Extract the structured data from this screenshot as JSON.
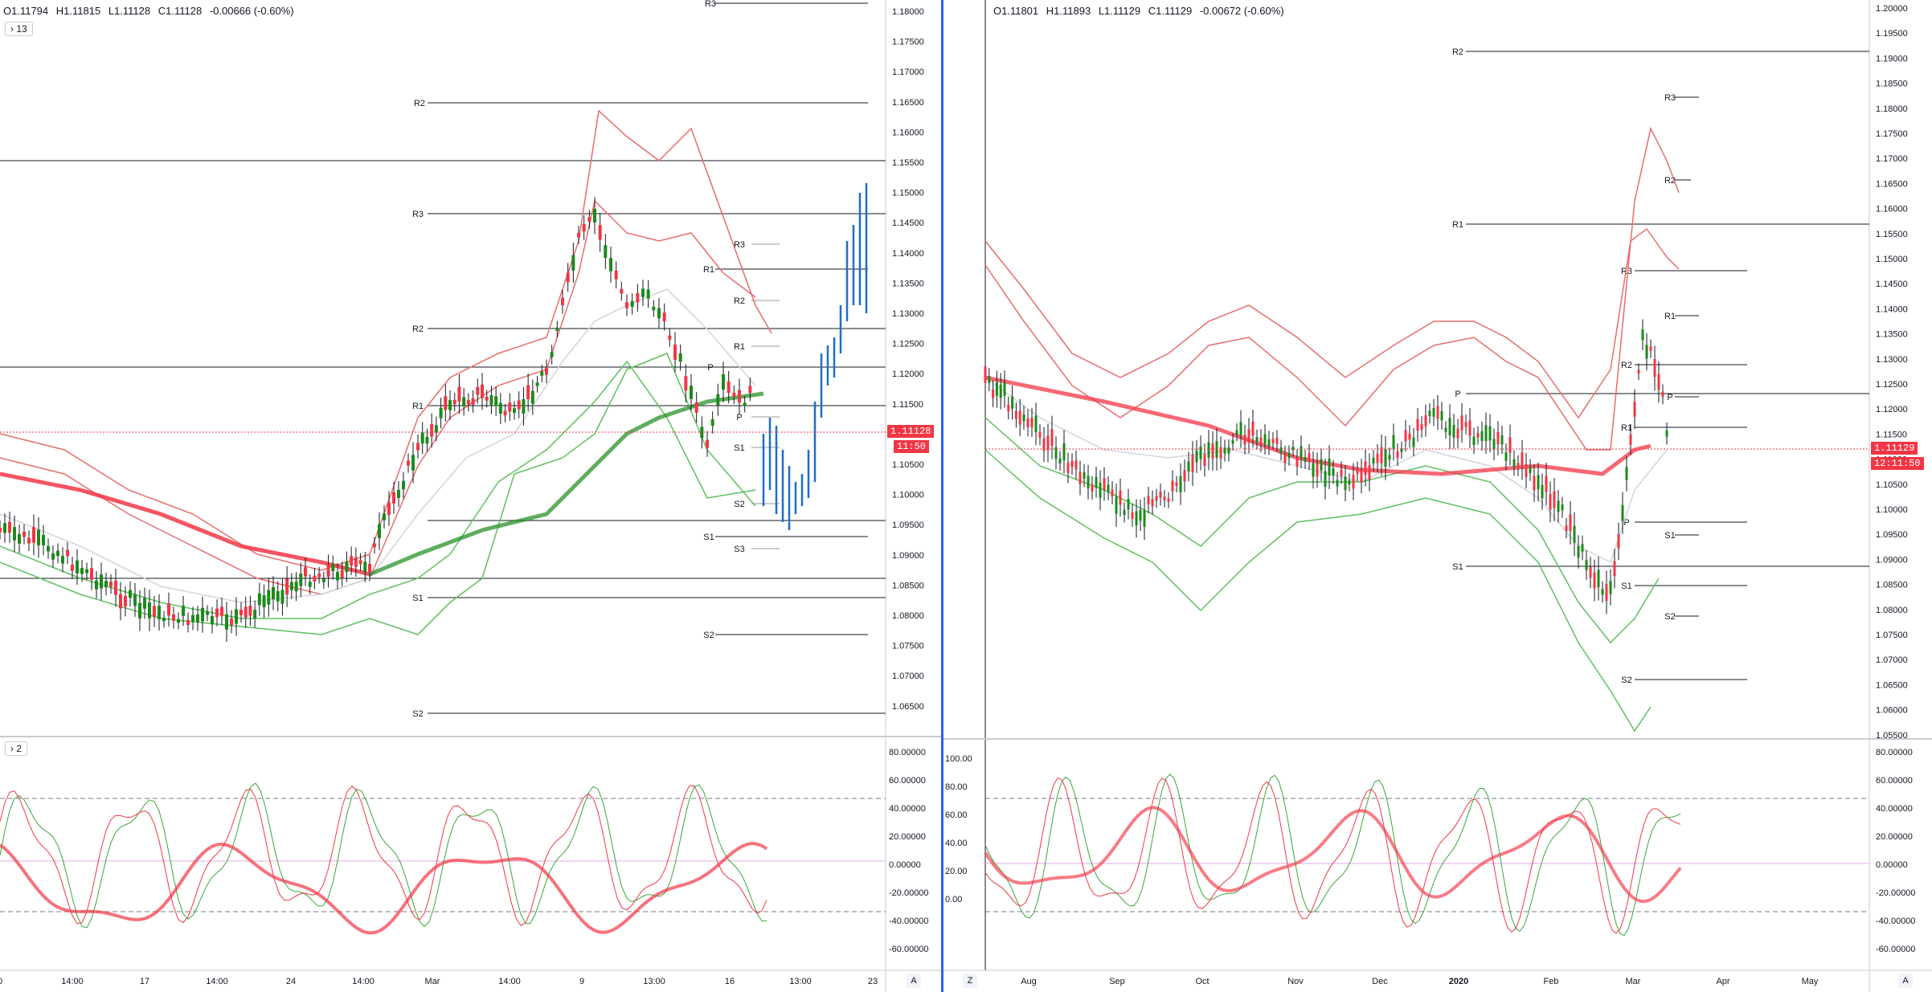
{
  "left": {
    "ohlc": {
      "open": "O1.11794",
      "high": "H1.11815",
      "low": "L1.11128",
      "close": "C1.11128",
      "change": "-0.00666 (-0.60%)"
    },
    "price_chip": "13",
    "osc_chip": "2",
    "last_price": "1.11128",
    "countdown": "11:50",
    "price_axis": [
      "1.18000",
      "1.17500",
      "1.17000",
      "1.16500",
      "1.16000",
      "1.15500",
      "1.15000",
      "1.14500",
      "1.14000",
      "1.13500",
      "1.13000",
      "1.12500",
      "1.12000",
      "1.11500",
      "1.11000",
      "1.10500",
      "1.10000",
      "1.09500",
      "1.09000",
      "1.08500",
      "1.08000",
      "1.07500",
      "1.07000",
      "1.06500"
    ],
    "osc_axis": [
      "80.00000",
      "60.00000",
      "40.00000",
      "20.00000",
      "0.00000",
      "-20.00000",
      "-40.00000",
      "-60.00000"
    ],
    "time_axis": [
      "0",
      "14:00",
      "17",
      "14:00",
      "24",
      "14:00",
      "Mar",
      "14:00",
      "9",
      "13:00",
      "16",
      "13:00",
      "23"
    ],
    "time_corner": "A",
    "levels": [
      "R3",
      "R2",
      "R3",
      "R1",
      "R2",
      "P",
      "R1",
      "S1",
      "S1",
      "S2",
      "S2",
      "R3",
      "R2",
      "R1",
      "P",
      "S1",
      "S2",
      "S3"
    ],
    "colors": {
      "up": "#1b8a1b",
      "down": "#f23645",
      "band_up": "#e86c6c",
      "band_low": "#5fbf5f",
      "projection": "#1e6ec8"
    }
  },
  "right": {
    "ohlc": {
      "open": "O1.11801",
      "high": "H1.11893",
      "low": "L1.11129",
      "close": "C1.11129",
      "change": "-0.00672 (-0.60%)"
    },
    "last_price": "1.11129",
    "countdown": "12:11:50",
    "price_axis": [
      "1.20000",
      "1.19500",
      "1.19000",
      "1.18500",
      "1.18000",
      "1.17500",
      "1.17000",
      "1.16500",
      "1.16000",
      "1.15500",
      "1.15000",
      "1.14500",
      "1.14000",
      "1.13500",
      "1.13000",
      "1.12500",
      "1.12000",
      "1.11500",
      "1.11000",
      "1.10500",
      "1.10000",
      "1.09500",
      "1.09000",
      "1.08500",
      "1.08000",
      "1.07500",
      "1.07000",
      "1.06500",
      "1.06000",
      "1.05500"
    ],
    "osc_left_axis": [
      "100.00",
      "80.00",
      "60.00",
      "40.00",
      "20.00",
      "0.00"
    ],
    "osc_right_axis": [
      "80.00000",
      "60.00000",
      "40.00000",
      "20.00000",
      "0.00000",
      "-20.00000",
      "-40.00000",
      "-60.00000"
    ],
    "time_axis": [
      "Aug",
      "Sep",
      "Oct",
      "Nov",
      "Dec",
      "2020",
      "Feb",
      "Mar",
      "Apr",
      "May"
    ],
    "time_corner_left": "Z",
    "time_corner_right": "A",
    "levels": [
      "R2",
      "R3",
      "R2",
      "R1",
      "R3",
      "R1",
      "R2",
      "P",
      "P",
      "R1",
      "P",
      "S1",
      "S1",
      "S1",
      "S2",
      "S2"
    ]
  }
}
